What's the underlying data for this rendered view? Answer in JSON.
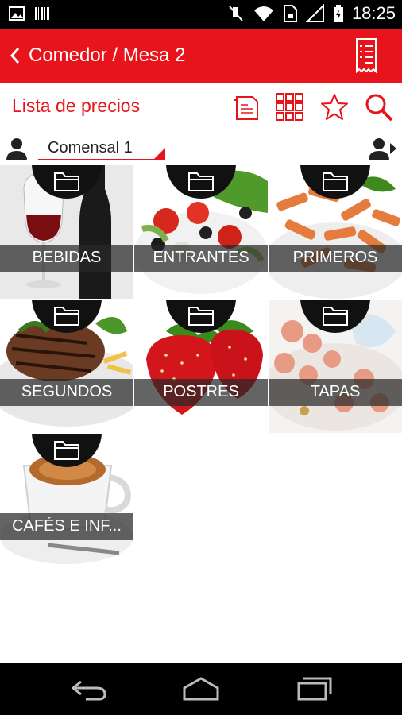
{
  "status_bar": {
    "time": "18:25",
    "left_icons": [
      "image-icon",
      "barcode-icon"
    ],
    "right_icons": [
      "mute-icon",
      "wifi-icon",
      "sim-icon",
      "signal-icon",
      "battery-icon"
    ]
  },
  "app_bar": {
    "title": "Comedor / Mesa 2",
    "back_icon": "chevron-left-icon",
    "action_icon": "receipt-icon",
    "color": "#e8141b"
  },
  "toolbar": {
    "title": "Lista de precios",
    "icons": [
      "document-icon",
      "grid-icon",
      "star-icon",
      "search-icon"
    ]
  },
  "diner": {
    "selected": "Comensal 1",
    "left_icon": "person-icon",
    "right_icon": "person-next-icon"
  },
  "categories": [
    {
      "label": "BEBIDAS",
      "image": "wine-glass-and-bottle"
    },
    {
      "label": "ENTRANTES",
      "image": "greek-salad"
    },
    {
      "label": "PRIMEROS",
      "image": "penne-pasta"
    },
    {
      "label": "SEGUNDOS",
      "image": "grilled-steak"
    },
    {
      "label": "POSTRES",
      "image": "strawberries"
    },
    {
      "label": "TAPAS",
      "image": "octopus-tapas"
    },
    {
      "label": "CAFÉS E INF...",
      "image": "coffee-cup"
    }
  ],
  "nav_bar": {
    "icons": [
      "back-nav-icon",
      "home-nav-icon",
      "recents-nav-icon"
    ]
  }
}
